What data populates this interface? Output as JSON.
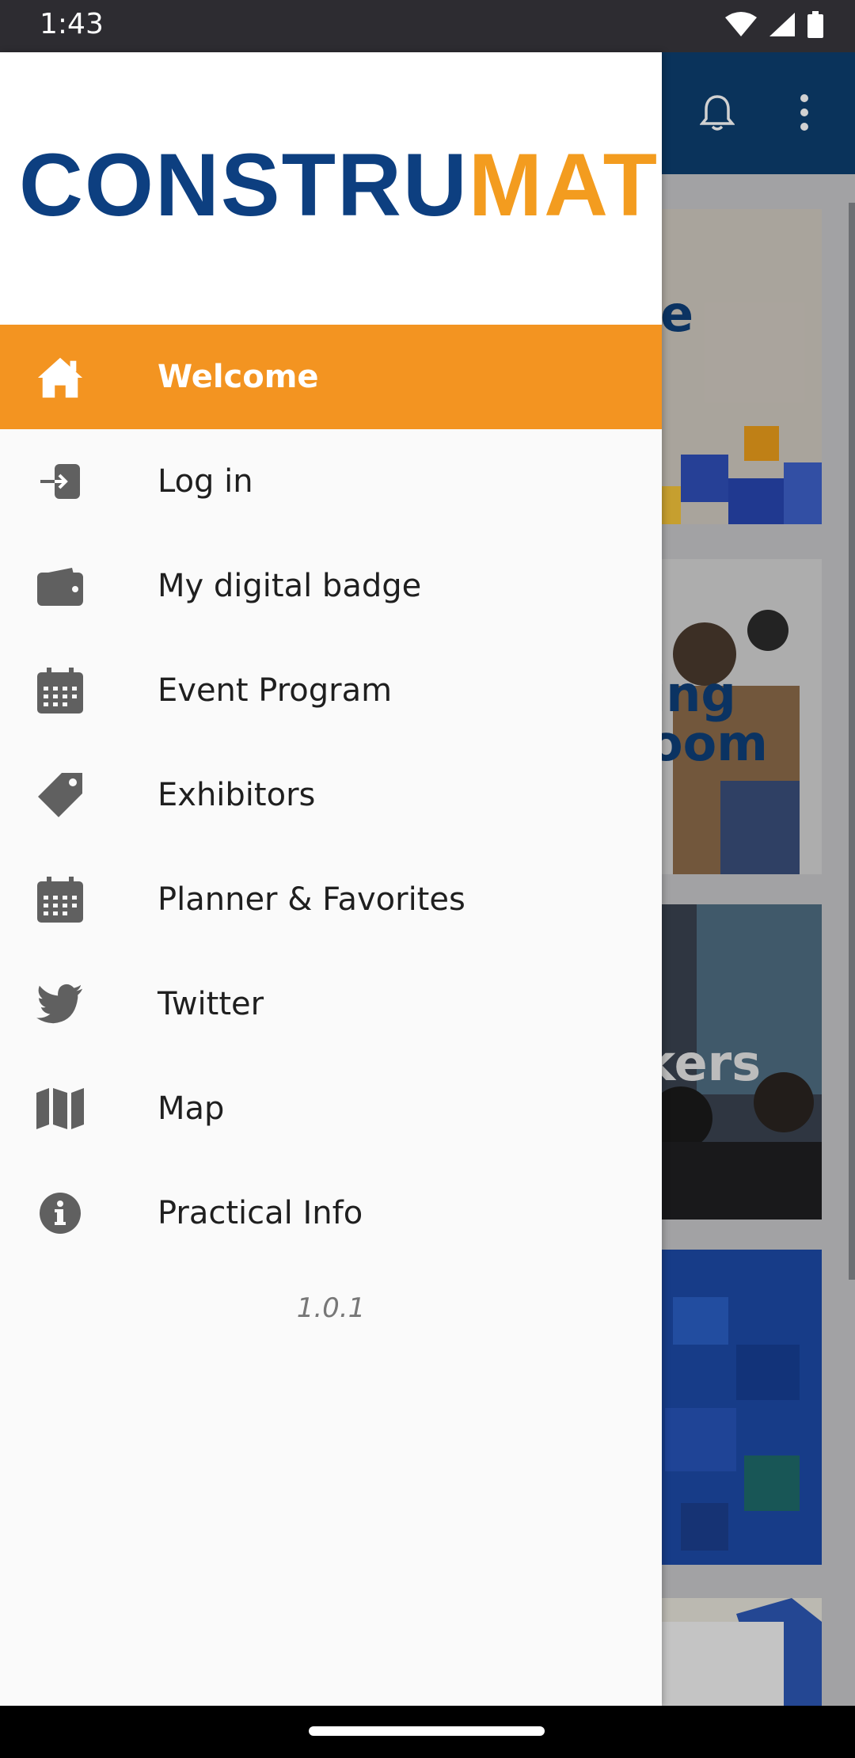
{
  "status_bar": {
    "time": "1:43",
    "icons": [
      "wifi-icon",
      "signal-icon",
      "battery-icon"
    ]
  },
  "brand": {
    "logo_part1": "CONSTRU",
    "logo_part2": "MAT",
    "primary_color": "#0d3f80",
    "accent_color": "#f39c1f"
  },
  "drawer": {
    "items": [
      {
        "label": "Welcome",
        "icon": "home-icon",
        "active": true
      },
      {
        "label": "Log in",
        "icon": "login-icon"
      },
      {
        "label": "My digital badge",
        "icon": "wallet-icon"
      },
      {
        "label": "Event Program",
        "icon": "calendar-icon"
      },
      {
        "label": "Exhibitors",
        "icon": "tag-icon"
      },
      {
        "label": "Planner & Favorites",
        "icon": "calendar-icon"
      },
      {
        "label": "Twitter",
        "icon": "twitter-icon"
      },
      {
        "label": "Map",
        "icon": "map-icon"
      },
      {
        "label": "Practical Info",
        "icon": "info-icon"
      }
    ],
    "version": "1.0.1"
  },
  "background": {
    "card_texts": [
      "e",
      "ing",
      "oom",
      "kers"
    ],
    "icons": [
      "bell-icon",
      "more-vert-icon"
    ]
  }
}
